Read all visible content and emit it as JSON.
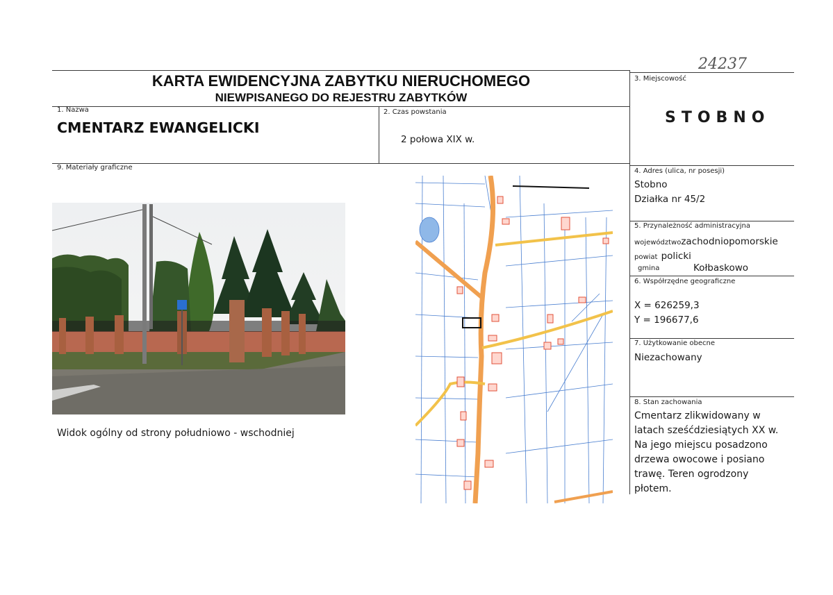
{
  "header": {
    "title_line1": "KARTA EWIDENCYJNA ZABYTKU NIERUCHOMEGO",
    "title_line2": "NIEWPISANEGO DO REJESTRU ZABYTKÓW",
    "registry_number": "24237"
  },
  "fields": {
    "name": {
      "label": "1. Nazwa",
      "value": "CMENTARZ EWANGELICKI"
    },
    "date": {
      "label": "2. Czas powstania",
      "value": "2 połowa XIX w."
    },
    "town": {
      "label": "3. Miejscowość",
      "value": "STOBNO"
    },
    "address": {
      "label": "4. Adres (ulica, nr posesji)",
      "line1": "Stobno",
      "line2": "Działka nr 45/2"
    },
    "admin": {
      "label": "5. Przynależność administracyjna",
      "voivodeship_label": "województwo",
      "voivodeship": "zachodniopomorskie",
      "county_label": "powiat",
      "county": "policki",
      "commune_label": "gmina",
      "commune": "Kołbaskowo"
    },
    "coords": {
      "label": "6. Współrzędne geograficzne",
      "x": "X = 626259,3",
      "y": "Y = 196677,6"
    },
    "usage": {
      "label": "7. Użytkowanie obecne",
      "value": "Niezachowany"
    },
    "condition": {
      "label": "8. Stan zachowania",
      "lines": [
        "Cmentarz zlikwidowany w",
        "latach sześćdziesiątych XX w.",
        "Na jego miejscu posadzono",
        "drzewa owocowe i posiano",
        "trawę. Teren ogrodzony",
        "płotem."
      ]
    },
    "graphics": {
      "label": "9. Materiały graficzne",
      "photo_caption": "Widok ogólny od strony południowo - wschodniej"
    }
  },
  "colors": {
    "road_orange": "#f0a050",
    "road_yellow": "#f2c24a",
    "parcel_lines": "#4a7fd0",
    "buildings": "#e0503a"
  }
}
